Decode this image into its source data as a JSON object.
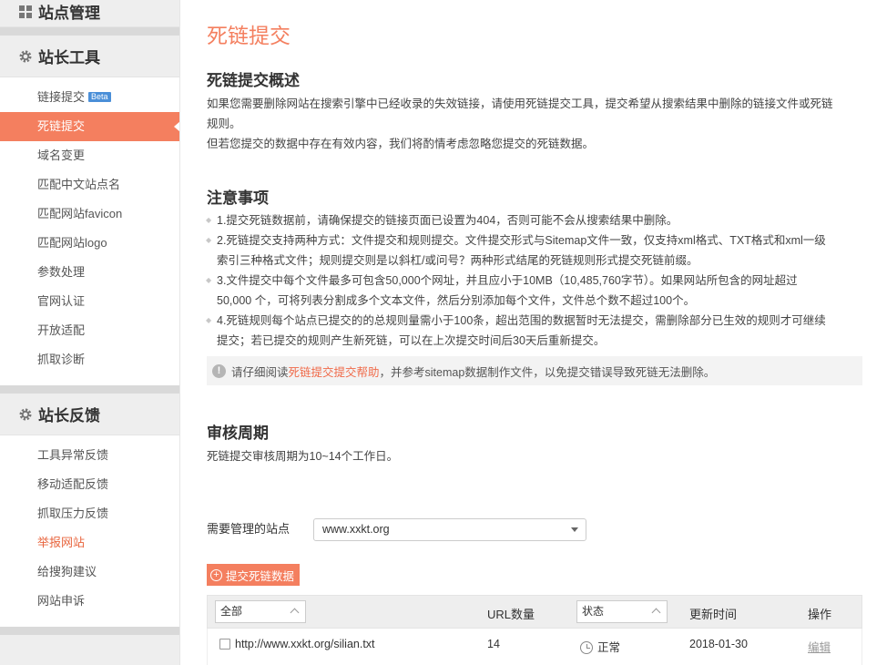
{
  "sidebar": {
    "section1": {
      "title": "站点管理"
    },
    "section2": {
      "title": "站长工具",
      "items": [
        {
          "label": "链接提交",
          "badge": "Beta"
        },
        {
          "label": "死链提交"
        },
        {
          "label": "域名变更"
        },
        {
          "label": "匹配中文站点名"
        },
        {
          "label": "匹配网站favicon"
        },
        {
          "label": "匹配网站logo"
        },
        {
          "label": "参数处理"
        },
        {
          "label": "官网认证"
        },
        {
          "label": "开放适配"
        },
        {
          "label": "抓取诊断"
        }
      ]
    },
    "section3": {
      "title": "站长反馈",
      "items": [
        {
          "label": "工具异常反馈"
        },
        {
          "label": "移动适配反馈"
        },
        {
          "label": "抓取压力反馈"
        },
        {
          "label": "举报网站"
        },
        {
          "label": "给搜狗建议"
        },
        {
          "label": "网站申诉"
        }
      ]
    }
  },
  "main": {
    "title": "死链提交",
    "overview": {
      "heading": "死链提交概述",
      "p1_line1": "如果您需要删除网站在搜索引擎中已经收录的失效链接，请使用死链提交工具，提交希望从搜索结果中删除的链接文件或死链",
      "p1_line2": "规则。",
      "p2": "但若您提交的数据中存在有效内容，我们将酌情考虑忽略您提交的死链数据。"
    },
    "notes": {
      "heading": "注意事项",
      "items": [
        [
          "1.提交死链数据前，请确保提交的链接页面已设置为404，否则可能不会从搜索结果中删除。"
        ],
        [
          "2.死链提交支持两种方式：文件提交和规则提交。文件提交形式与Sitemap文件一致，仅支持xml格式、TXT格式和xml一级",
          "索引三种格式文件；规则提交则是以斜杠/或问号？两种形式结尾的死链规则形式提交死链前缀。"
        ],
        [
          "3.文件提交中每个文件最多可包含50,000个网址，并且应小于10MB（10,485,760字节）。如果网站所包含的网址超过",
          "50,000 个，可将列表分割成多个文本文件，然后分别添加每个文件，文件总个数不超过100个。"
        ],
        [
          "4.死链规则每个站点已提交的的总规则量需小于100条，超出范围的数据暂时无法提交，需删除部分已生效的规则才可继续",
          "提交；若已提交的规则产生新死链，可以在上次提交时间后30天后重新提交。"
        ]
      ],
      "warn_prefix": "请仔细阅读",
      "warn_link": "死链提交提交帮助",
      "warn_suffix": "，并参考sitemap数据制作文件，以免提交错误导致死链无法删除。",
      "warn_icon": "!"
    },
    "cycle": {
      "heading": "审核周期",
      "text": "死链提交审核周期为10~14个工作日。"
    },
    "site_label": "需要管理的站点",
    "site_value": "www.xxkt.org",
    "submit_label": "提交死链数据",
    "table": {
      "filter_all": "全部",
      "col_url_count": "URL数量",
      "filter_status": "状态",
      "col_update_time": "更新时间",
      "col_action": "操作",
      "rows": [
        {
          "url": "http://www.xxkt.org/silian.txt",
          "count": "14",
          "status": "正常",
          "time": "2018-01-30",
          "action": "编辑"
        }
      ]
    }
  },
  "colors": {
    "accent": "#f47f5f",
    "link": "#f06b4a",
    "beta": "#4a8fd8"
  }
}
